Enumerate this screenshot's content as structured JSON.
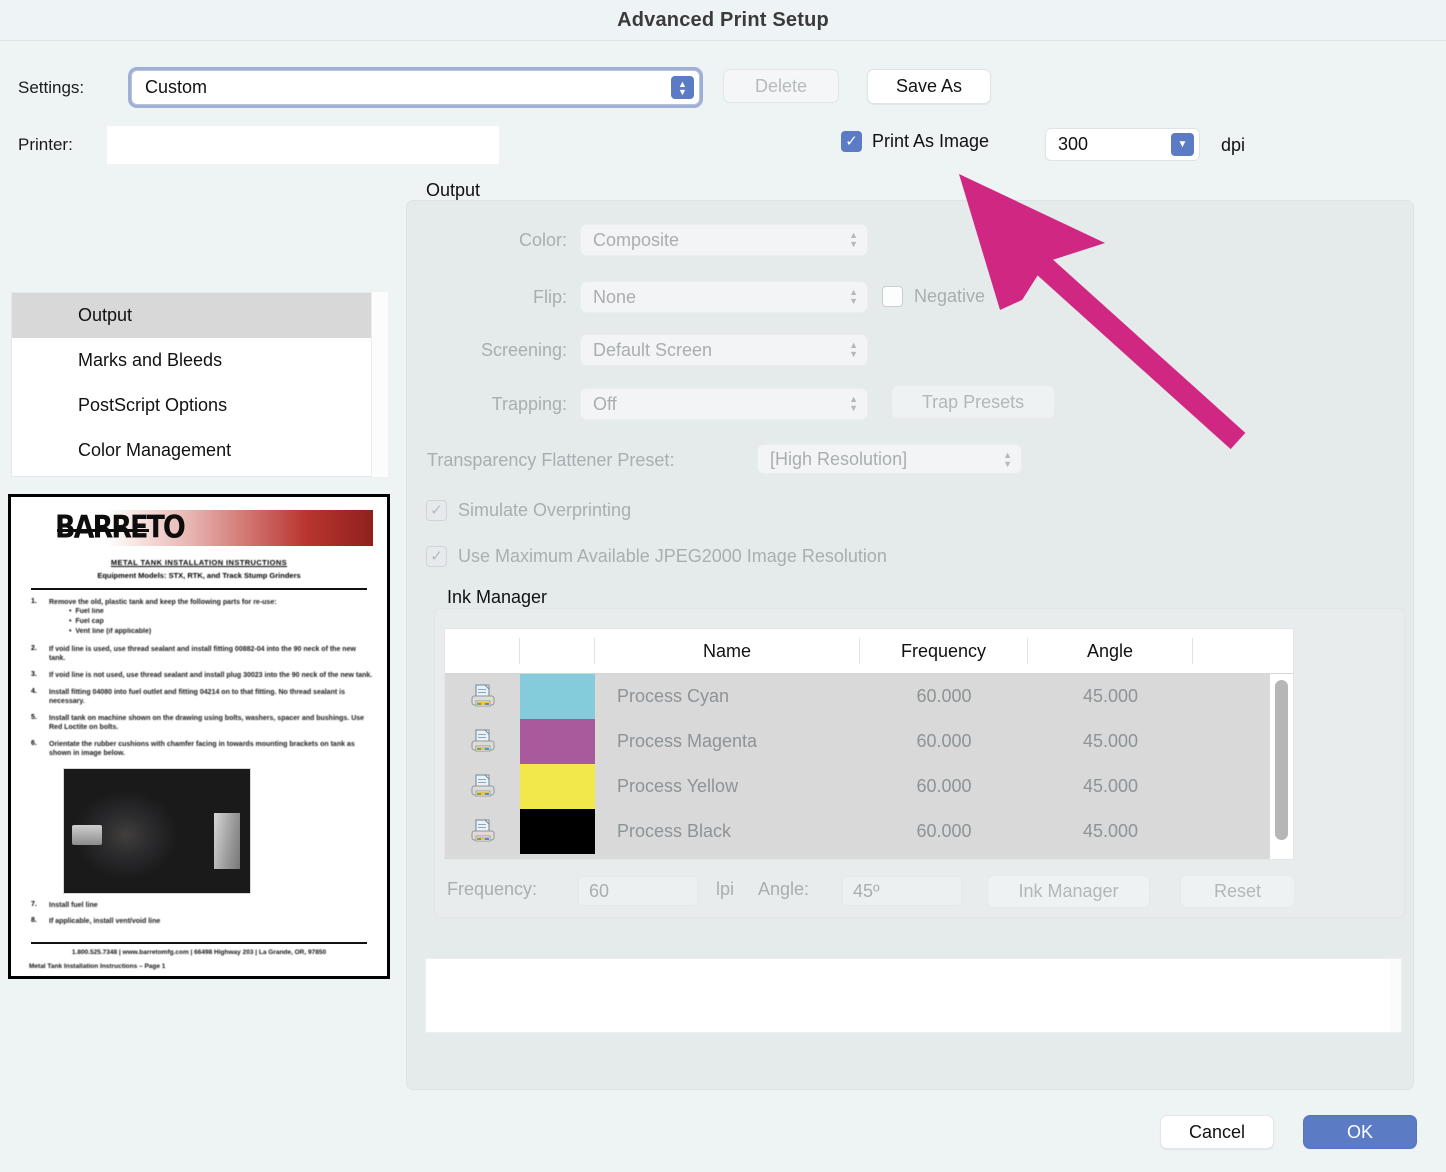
{
  "window": {
    "title": "Advanced Print Setup"
  },
  "top": {
    "settings_label": "Settings:",
    "settings_value": "Custom",
    "printer_label": "Printer:",
    "printer_value": "",
    "delete_label": "Delete",
    "save_as_label": "Save As",
    "print_as_image_label": "Print As Image",
    "print_as_image_checked": "✓",
    "dpi_value": "300",
    "dpi_unit": "dpi"
  },
  "nav": {
    "items": [
      {
        "label": "Output",
        "selected": true
      },
      {
        "label": "Marks and Bleeds",
        "selected": false
      },
      {
        "label": "PostScript Options",
        "selected": false
      },
      {
        "label": "Color Management",
        "selected": false
      }
    ]
  },
  "preview": {
    "logo": "BARRETO",
    "doc_title": "METAL TANK INSTALLATION INSTRUCTIONS",
    "doc_subtitle": "Equipment Models: STX, RTK, and Track Stump Grinders",
    "steps": [
      {
        "num": "1.",
        "text": "Remove the old, plastic tank and keep the following parts for re-use:"
      },
      {
        "num": "2.",
        "text": "If void line is used, use thread sealant and install fitting 00882-04 into the 90 neck of the new tank."
      },
      {
        "num": "3.",
        "text": "If void line is not used, use thread sealant and install plug 30023 into the 90 neck of the new tank."
      },
      {
        "num": "4.",
        "text": "Install fitting 04080 into fuel outlet and fitting 04214 on to that fitting. No thread sealant is necessary."
      },
      {
        "num": "5.",
        "text": "Install tank on machine shown on the drawing using bolts, washers, spacer and bushings. Use Red Loctite on bolts."
      },
      {
        "num": "6.",
        "text": "Orientate the rubber cushions with chamfer facing in towards mounting brackets on tank as shown in image below."
      }
    ],
    "bullets": [
      "Fuel line",
      "Fuel cap",
      "Vent line (if applicable)"
    ],
    "steps2": [
      {
        "num": "7.",
        "text": "Install fuel line"
      },
      {
        "num": "8.",
        "text": "If applicable, install vent/void line"
      }
    ],
    "footer": "1.800.525.7348  |  www.barretomfg.com  |  66498 Highway 203  |  La Grande, OR, 97850",
    "footer2": "Metal Tank Installation Instructions – Page 1"
  },
  "output": {
    "legend": "Output",
    "color_label": "Color:",
    "color_value": "Composite",
    "flip_label": "Flip:",
    "flip_value": "None",
    "negative_label": "Negative",
    "negative_checked": "",
    "screening_label": "Screening:",
    "screening_value": "Default Screen",
    "trapping_label": "Trapping:",
    "trapping_value": "Off",
    "trap_presets_label": "Trap Presets",
    "tfp_label": "Transparency Flattener Preset:",
    "tfp_value": "[High Resolution]",
    "simulate_label": "Simulate Overprinting",
    "simulate_checked": "✓",
    "jpeg_label": "Use Maximum Available JPEG2000 Image Resolution",
    "jpeg_checked": "✓"
  },
  "ink_manager": {
    "legend": "Ink Manager",
    "columns": [
      "",
      "",
      "Name",
      "Frequency",
      "Angle"
    ],
    "rows": [
      {
        "icon": "printer-icon",
        "swatch": "#84ccdc",
        "name": "Process Cyan",
        "frequency": "60.000",
        "angle": "45.000"
      },
      {
        "icon": "printer-icon",
        "swatch": "#a85a9d",
        "name": "Process Magenta",
        "frequency": "60.000",
        "angle": "45.000"
      },
      {
        "icon": "printer-icon",
        "swatch": "#f2e84c",
        "name": "Process Yellow",
        "frequency": "60.000",
        "angle": "45.000"
      },
      {
        "icon": "printer-icon",
        "swatch": "#000000",
        "name": "Process Black",
        "frequency": "60.000",
        "angle": "45.000"
      }
    ],
    "frequency_label": "Frequency:",
    "frequency_value": "60",
    "lpi_label": "lpi",
    "angle_label": "Angle:",
    "angle_value": "45º",
    "ink_manager_button": "Ink Manager",
    "reset_button": "Reset"
  },
  "description": {
    "text": ""
  },
  "footer": {
    "cancel_label": "Cancel",
    "ok_label": "OK"
  },
  "annotation": {
    "arrow_color": "#d02882"
  }
}
